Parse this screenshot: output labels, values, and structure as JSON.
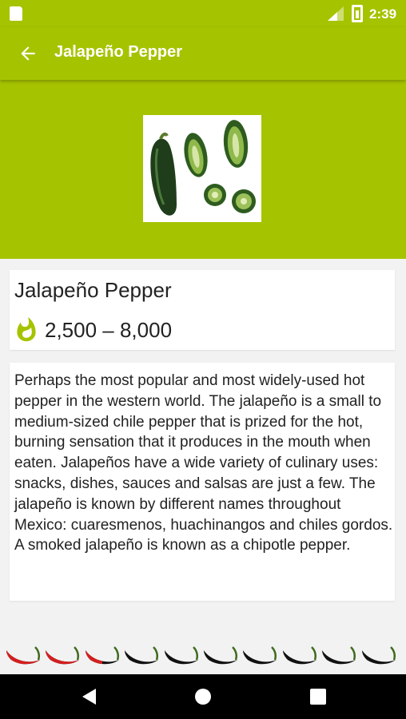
{
  "status_bar": {
    "time": "2:39",
    "icons": [
      "sd-card-icon",
      "signal-icon",
      "battery-icon"
    ]
  },
  "app_bar": {
    "title": "Jalapeño Pepper",
    "back_icon": "arrow-back-icon"
  },
  "pepper": {
    "name": "Jalapeño Pepper",
    "scoville_range": "2,500 – 8,000",
    "description": "Perhaps the most popular and most widely-used hot pepper in the western world. The jalapeño is a small to medium-sized chile pepper that is prized for the hot, burning sensation that it produces in the mouth when eaten. Jalapeños have a wide variety of culinary uses: snacks, dishes, sauces and salsas are just a few.  The jalapeño is known by different names throughout Mexico: cuaresmenos, huachinangos and chiles gordos.  A smoked jalapeño is known as a chipotle pepper.",
    "heat_rating": {
      "value": 2.5,
      "max": 10
    }
  },
  "colors": {
    "accent": "#a6c300",
    "hot": "#d41e1e",
    "cold": "#111111"
  },
  "nav_bar": [
    "back-triangle-icon",
    "home-circle-icon",
    "recents-square-icon"
  ]
}
